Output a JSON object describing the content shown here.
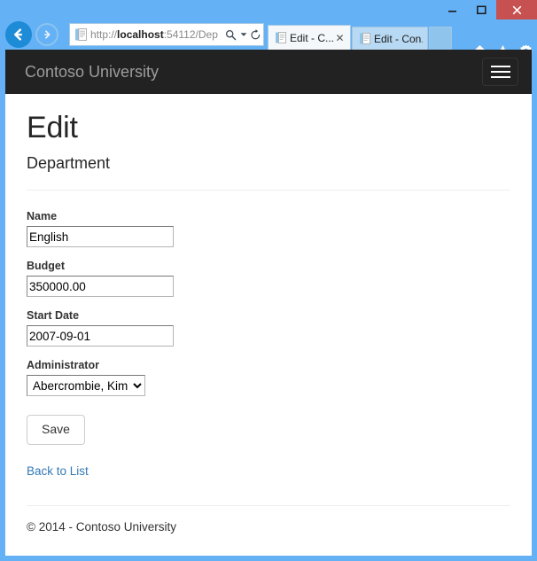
{
  "browser": {
    "window_controls": {
      "minimize": "minimize",
      "maximize": "maximize",
      "close": "close"
    },
    "navigation": {
      "back": "Back",
      "forward": "Forward"
    },
    "address": {
      "url_prefix": "http://",
      "url_host": "localhost",
      "url_suffix": ":54112/Dep",
      "full_url": "http://localhost:54112/Dep",
      "search_icon": "search-icon",
      "caret_icon": "chevron-down-icon",
      "refresh_icon": "refresh-icon"
    },
    "tabs": [
      {
        "title": "Edit - C...",
        "active": true,
        "close_label": "✕"
      },
      {
        "title": "Edit - Con...",
        "active": false,
        "close_label": ""
      }
    ],
    "new_tab_label": "",
    "tools": [
      {
        "name": "home-icon",
        "label": "Home"
      },
      {
        "name": "favorites-icon",
        "label": "Favorites"
      },
      {
        "name": "settings-icon",
        "label": "Tools"
      }
    ]
  },
  "site": {
    "brand": "Contoso University",
    "nav_toggle_label": "Toggle navigation"
  },
  "page": {
    "title": "Edit",
    "subtitle": "Department"
  },
  "form": {
    "fields": [
      {
        "label": "Name",
        "value": "English",
        "type": "text"
      },
      {
        "label": "Budget",
        "value": "350000.00",
        "type": "text"
      },
      {
        "label": "Start Date",
        "value": "2007-09-01",
        "type": "text"
      },
      {
        "label": "Administrator",
        "value": "Abercrombie, Kim",
        "type": "select"
      }
    ],
    "submit_label": "Save",
    "back_link_label": "Back to List"
  },
  "footer": {
    "text": "© 2014 - Contoso University"
  },
  "colors": {
    "chrome_blue": "#64b1f5",
    "close_red": "#c75050",
    "navbar_dark": "#222222",
    "brand_gray": "#9d9d9d",
    "link_blue": "#337ab7"
  }
}
